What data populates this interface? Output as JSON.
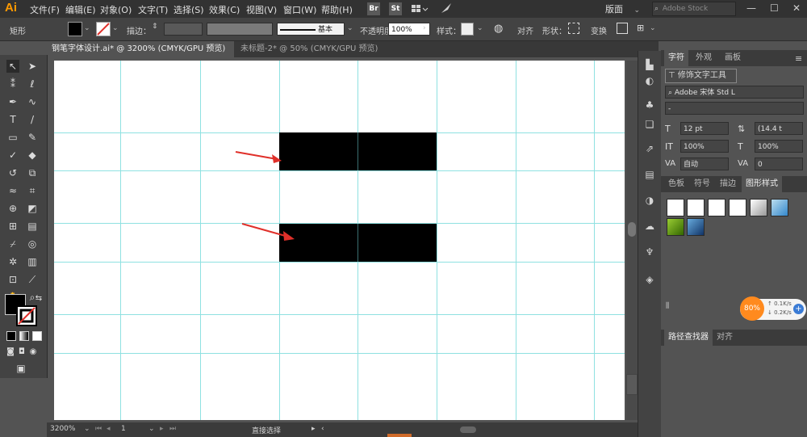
{
  "app": {
    "logo": "Ai"
  },
  "menu": [
    "文件(F)",
    "编辑(E)",
    "对象(O)",
    "文字(T)",
    "选择(S)",
    "效果(C)",
    "视图(V)",
    "窗口(W)",
    "帮助(H)"
  ],
  "menu_buttons": {
    "bridge": "Br",
    "stock": "St"
  },
  "workspace": {
    "label": "版面"
  },
  "search": {
    "placeholder": "Adobe Stock"
  },
  "control_bar": {
    "object_type": "矩形",
    "stroke_label": "描边：",
    "stroke_style": "基本",
    "opacity_label": "不透明度：",
    "opacity_value": "100%",
    "style_label": "样式：",
    "align_label": "对齐",
    "shape_label": "形状：",
    "transform_label": "变换"
  },
  "tabs": [
    {
      "label": "钢笔字体设计.ai* @ 3200% (CMYK/GPU 预览)",
      "close": "×"
    },
    {
      "label": "未标题-2* @ 50% (CMYK/GPU 预览)",
      "close": "×"
    }
  ],
  "status": {
    "zoom": "3200%",
    "page": "1",
    "tool": "直接选择"
  },
  "char_panel": {
    "tabs": [
      "字符",
      "外观",
      "画板"
    ],
    "touch_tool": "修饰文字工具",
    "font_family": "Adobe 宋体 Std L",
    "font_style": "-",
    "font_size": "12 pt",
    "leading": "(14.4 t",
    "vscale": "100%",
    "hscale": "100%",
    "kerning": "自动",
    "tracking": "0"
  },
  "styles_panel": {
    "tabs": [
      "色板",
      "符号",
      "描边",
      "图形样式"
    ]
  },
  "path_panel": {
    "tabs": [
      "路径查找器",
      "对齐"
    ]
  },
  "net_widget": {
    "percent": "80%",
    "up": "0.1K/s",
    "down": "0.2K/s"
  },
  "colors": {
    "accent": "#ff9a00",
    "guide": "#8fe1e1",
    "arrow": "#e0302a"
  }
}
